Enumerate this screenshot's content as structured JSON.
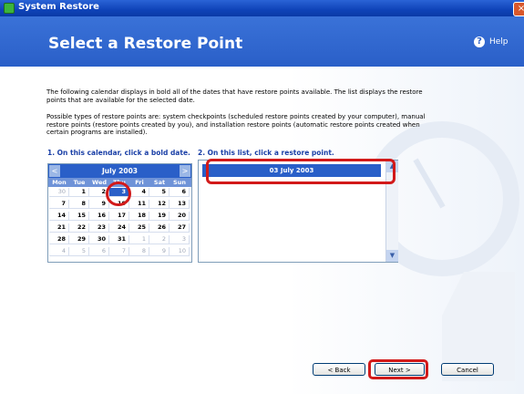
{
  "window": {
    "title": "System Restore",
    "close_glyph": "×"
  },
  "header": {
    "heading": "Select a Restore Point",
    "help_label": "Help",
    "help_glyph": "?"
  },
  "body": {
    "intro": "The following calendar displays in bold all of the dates that have restore points available. The list displays the restore points that are available for the selected date.",
    "types": "Possible types of restore points are: system checkpoints (scheduled restore points created by your computer), manual restore points (restore points created by you), and installation restore points (automatic restore points created when certain programs are installed)."
  },
  "steps": {
    "step1": "1. On this calendar, click a bold date.",
    "step2": "2. On this list, click a restore point."
  },
  "calendar": {
    "month": "July 2003",
    "prev_glyph": "<",
    "next_glyph": ">",
    "dows": [
      "Mon",
      "Tue",
      "Wed",
      "Thu",
      "Fri",
      "Sat",
      "Sun"
    ],
    "weeks": [
      [
        "30",
        "1",
        "2",
        "3",
        "4",
        "5",
        "6"
      ],
      [
        "7",
        "8",
        "9",
        "10",
        "11",
        "12",
        "13"
      ],
      [
        "14",
        "15",
        "16",
        "17",
        "18",
        "19",
        "20"
      ],
      [
        "21",
        "22",
        "23",
        "24",
        "25",
        "26",
        "27"
      ],
      [
        "28",
        "29",
        "30",
        "31",
        "1",
        "2",
        "3"
      ],
      [
        "4",
        "5",
        "6",
        "7",
        "8",
        "9",
        "10"
      ]
    ],
    "selected": "3"
  },
  "restore_list": {
    "items": [
      "03 July 2003"
    ],
    "scroll_up": "▲",
    "scroll_down": "▼"
  },
  "buttons": {
    "back": "< Back",
    "next": "Next >",
    "cancel": "Cancel"
  },
  "colors": {
    "accent": "#2a5fc8",
    "highlight_ring": "#d21a1a"
  }
}
